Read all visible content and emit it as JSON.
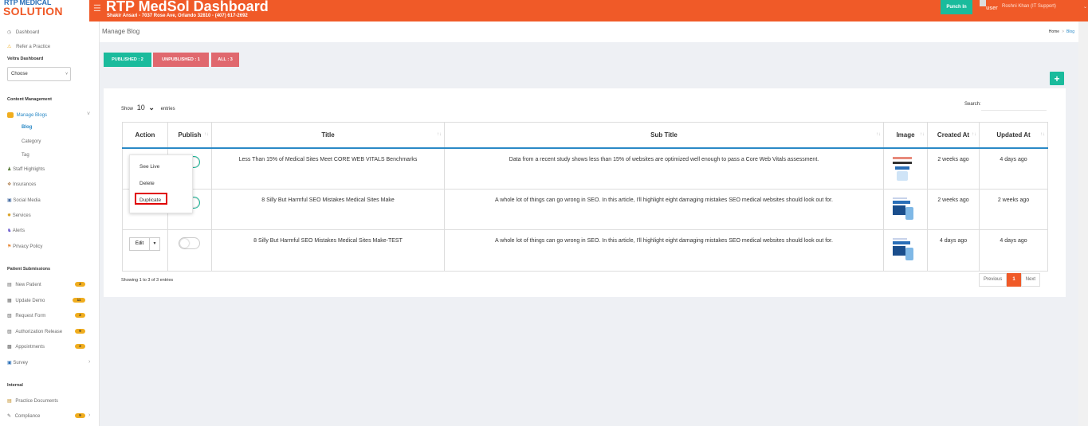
{
  "header": {
    "logo_line1": "RTP MEDICAL",
    "logo_line2": "SOLUTION",
    "title": "RTP MedSol Dashboard",
    "subtitle": "Shakir Ansari - 7037 Rose Ave, Orlando 32810 - (407) 617-2692",
    "punch_in_label": "Punch In",
    "user_word": "user",
    "user_name": "Roshni Khan (IT Support)"
  },
  "sidebar": {
    "dashboard": "Dashboard",
    "refer": "Refer a Practice",
    "veltra_head": "Veltra Dashboard",
    "choose_value": "Choose",
    "content_head": "Content Management",
    "manage_blogs": "Manage Blogs",
    "blog": "Blog",
    "category": "Category",
    "tag": "Tag",
    "staff": "Staff Highlights",
    "insurances": "Insurances",
    "social": "Social Media",
    "services": "Services",
    "alerts": "Alerts",
    "privacy": "Privacy Policy",
    "patient_head": "Patient Submissions",
    "new_patient": "New Patient",
    "new_patient_badge": "2",
    "update_demo": "Update Demo",
    "update_demo_badge": "11",
    "request_form": "Request Form",
    "request_form_badge": "2",
    "auth_release": "Authorization Release",
    "auth_release_badge": "9",
    "appointments": "Appointments",
    "appointments_badge": "2",
    "survey": "Survey",
    "internal_head": "Internal",
    "practice_docs": "Practice Documents",
    "compliance": "Compliance",
    "compliance_badge": "9"
  },
  "page": {
    "title": "Manage Blog",
    "crumb_home": "Home",
    "crumb_sep": ">",
    "crumb_current": "Blog"
  },
  "filters": {
    "published": "PUBLISHED : 2",
    "unpublished": "UNPUBLISHED : 1",
    "all": "ALL : 3",
    "add": "+"
  },
  "table_controls": {
    "show": "Show",
    "show_value": "10",
    "entries": "entries",
    "search_label": "Search:"
  },
  "columns": [
    "Action",
    "Publish",
    "Title",
    "Sub Title",
    "Image",
    "Created At",
    "Updated At"
  ],
  "rows": [
    {
      "title": "Less Than 15% of Medical Sites Meet CORE WEB VITALS Benchmarks",
      "subtitle": "Data from a recent study shows less than 15% of websites are optimized well enough to pass a Core Web Vitals assessment.",
      "created": "2 weeks ago",
      "updated": "4 days ago",
      "published": true
    },
    {
      "title": "8 Silly But Harmful SEO Mistakes Medical Sites Make",
      "subtitle": "A whole lot of things can go wrong in SEO. In this article, I'll highlight eight damaging mistakes SEO medical websites should look out for.",
      "created": "2 weeks ago",
      "updated": "2 weeks ago",
      "published": true
    },
    {
      "title": "8 Silly But Harmful SEO Mistakes Medical Sites Make-TEST",
      "subtitle": "A whole lot of things can go wrong in SEO. In this article, I'll highlight eight damaging mistakes SEO medical websites should look out for.",
      "created": "4 days ago",
      "updated": "4 days ago",
      "published": false,
      "edit_label": "Edit"
    }
  ],
  "menu": {
    "see_live": "See Live",
    "delete": "Delete",
    "duplicate": "Duplicate"
  },
  "footer": {
    "showing": "Showing 1 to 3 of 3 entries",
    "previous": "Previous",
    "page_1": "1",
    "next": "Next"
  },
  "colors": {
    "brand_orange": "#f05a28",
    "teal": "#1abb9c",
    "unpublished_red": "#e0686e",
    "link_blue": "#2a89c6",
    "highlight_red": "#e00000"
  }
}
